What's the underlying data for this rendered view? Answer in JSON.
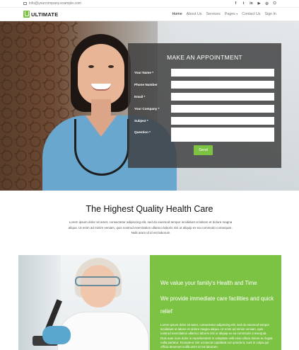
{
  "topbar": {
    "email": "info@yourcompany.example.com",
    "social": [
      "f",
      "t",
      "in",
      "▶",
      "◎",
      "⎔"
    ],
    "social_icons": [
      "facebook-icon",
      "twitter-icon",
      "linkedin-icon",
      "youtube-icon",
      "instagram-icon",
      "github-icon"
    ]
  },
  "header": {
    "logo_text": "ULTIMATE",
    "nav": [
      {
        "label": "Home",
        "active": true
      },
      {
        "label": "About Us"
      },
      {
        "label": "Services"
      },
      {
        "label": "Pages"
      },
      {
        "label": "Contact Us"
      },
      {
        "label": "Sign In"
      }
    ],
    "pages_caret": "▾"
  },
  "appointment": {
    "title": "MAKE AN APPOINTMENT",
    "fields": [
      {
        "label": "Your Name *",
        "value": ""
      },
      {
        "label": "Phone Number",
        "value": ""
      },
      {
        "label": "Email *",
        "value": ""
      },
      {
        "label": "Your Company *",
        "value": ""
      },
      {
        "label": "Subject *",
        "value": ""
      },
      {
        "label": "Question *",
        "value": ""
      }
    ],
    "send_label": "Send"
  },
  "quality": {
    "title": "The Highest Quality Health Care",
    "text": "Lorem ipsum dolor sit amet, consectetur adipiscing elit, sed do eiusmod tempor incididunt ut labore et dolore magna aliqua. Ut enim ad minim veniam, quis nostrud exercitation ullamco laboris nisi ut aliquip ex ea commodo consequat . Nulit aram id id est laborum"
  },
  "feature": {
    "heading1": "We value your family's Health and Time",
    "heading2": "We provide immediate care facilities and quick relief",
    "text": "Lorem ipsum dolor sit amet, consectetur adipiscing elit, sed do eiusmod tempor incididunt ut labore et dolore magna aliqua. Ut enim ad minim veniam, quis nostrud exercitation ullamco laboris nisi ut aliquip ex ea commodo consequat. Duis aute irure dolor in reprehenderit in voluptate velit esse cillum dolore eu fugiat nulla pariatur. Excepteur sint occaecat cupidatat non proident, sunt in culpa qui officia deserunt mollit anim id est laborum."
  },
  "colors": {
    "accent": "#7cc243",
    "form_overlay": "#3c3c3c"
  }
}
